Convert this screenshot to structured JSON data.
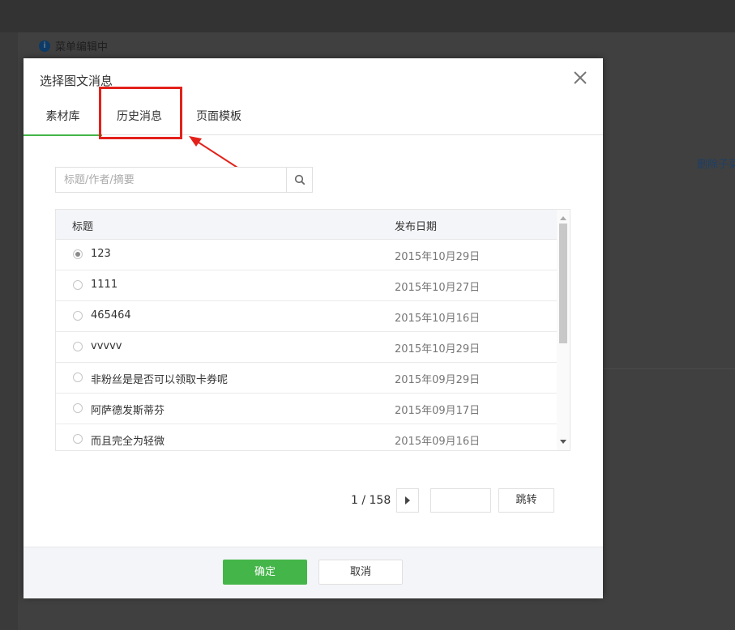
{
  "background": {
    "notice_text": "菜单编辑中",
    "notice_icon": "info-icon",
    "side_link": "删除子菜"
  },
  "dialog": {
    "title": "选择图文消息",
    "close_icon": "close-icon",
    "tabs": [
      {
        "label": "素材库",
        "active": true
      },
      {
        "label": "历史消息",
        "active": false
      },
      {
        "label": "页面模板",
        "active": false
      }
    ],
    "search": {
      "placeholder": "标题/作者/摘要",
      "value": "",
      "icon": "search-icon"
    },
    "table": {
      "headers": [
        "标题",
        "发布日期"
      ],
      "rows": [
        {
          "title": "123",
          "date": "2015年10月29日",
          "selected": true
        },
        {
          "title": "1111",
          "date": "2015年10月27日",
          "selected": false
        },
        {
          "title": "465464",
          "date": "2015年10月16日",
          "selected": false
        },
        {
          "title": "vvvvv",
          "date": "2015年10月29日",
          "selected": false
        },
        {
          "title": "非粉丝是是否可以领取卡券呢",
          "date": "2015年09月29日",
          "selected": false
        },
        {
          "title": "阿萨德发斯蒂芬",
          "date": "2015年09月17日",
          "selected": false
        },
        {
          "title": "而且完全为轻微",
          "date": "2015年09月16日",
          "selected": false
        }
      ]
    },
    "pager": {
      "page_info": "1 / 158",
      "jump_label": "跳转",
      "page_input": ""
    },
    "footer": {
      "ok_label": "确定",
      "cancel_label": "取消"
    },
    "colors": {
      "accent": "#44b549",
      "highlight": "#e3211a"
    }
  }
}
